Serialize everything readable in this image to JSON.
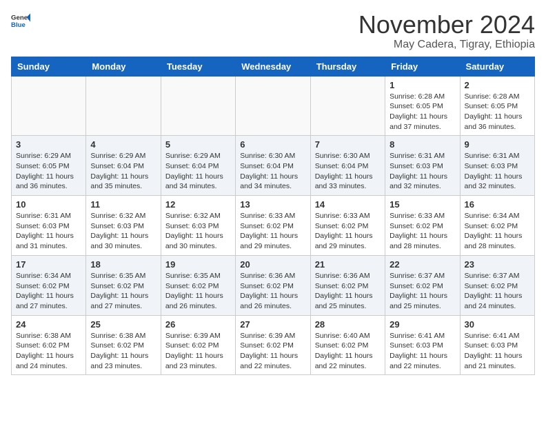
{
  "header": {
    "logo_general": "General",
    "logo_blue": "Blue",
    "month": "November 2024",
    "location": "May Cadera, Tigray, Ethiopia"
  },
  "weekdays": [
    "Sunday",
    "Monday",
    "Tuesday",
    "Wednesday",
    "Thursday",
    "Friday",
    "Saturday"
  ],
  "weeks": [
    [
      {
        "day": "",
        "info": ""
      },
      {
        "day": "",
        "info": ""
      },
      {
        "day": "",
        "info": ""
      },
      {
        "day": "",
        "info": ""
      },
      {
        "day": "",
        "info": ""
      },
      {
        "day": "1",
        "info": "Sunrise: 6:28 AM\nSunset: 6:05 PM\nDaylight: 11 hours and 37 minutes."
      },
      {
        "day": "2",
        "info": "Sunrise: 6:28 AM\nSunset: 6:05 PM\nDaylight: 11 hours and 36 minutes."
      }
    ],
    [
      {
        "day": "3",
        "info": "Sunrise: 6:29 AM\nSunset: 6:05 PM\nDaylight: 11 hours and 36 minutes."
      },
      {
        "day": "4",
        "info": "Sunrise: 6:29 AM\nSunset: 6:04 PM\nDaylight: 11 hours and 35 minutes."
      },
      {
        "day": "5",
        "info": "Sunrise: 6:29 AM\nSunset: 6:04 PM\nDaylight: 11 hours and 34 minutes."
      },
      {
        "day": "6",
        "info": "Sunrise: 6:30 AM\nSunset: 6:04 PM\nDaylight: 11 hours and 34 minutes."
      },
      {
        "day": "7",
        "info": "Sunrise: 6:30 AM\nSunset: 6:04 PM\nDaylight: 11 hours and 33 minutes."
      },
      {
        "day": "8",
        "info": "Sunrise: 6:31 AM\nSunset: 6:03 PM\nDaylight: 11 hours and 32 minutes."
      },
      {
        "day": "9",
        "info": "Sunrise: 6:31 AM\nSunset: 6:03 PM\nDaylight: 11 hours and 32 minutes."
      }
    ],
    [
      {
        "day": "10",
        "info": "Sunrise: 6:31 AM\nSunset: 6:03 PM\nDaylight: 11 hours and 31 minutes."
      },
      {
        "day": "11",
        "info": "Sunrise: 6:32 AM\nSunset: 6:03 PM\nDaylight: 11 hours and 30 minutes."
      },
      {
        "day": "12",
        "info": "Sunrise: 6:32 AM\nSunset: 6:03 PM\nDaylight: 11 hours and 30 minutes."
      },
      {
        "day": "13",
        "info": "Sunrise: 6:33 AM\nSunset: 6:02 PM\nDaylight: 11 hours and 29 minutes."
      },
      {
        "day": "14",
        "info": "Sunrise: 6:33 AM\nSunset: 6:02 PM\nDaylight: 11 hours and 29 minutes."
      },
      {
        "day": "15",
        "info": "Sunrise: 6:33 AM\nSunset: 6:02 PM\nDaylight: 11 hours and 28 minutes."
      },
      {
        "day": "16",
        "info": "Sunrise: 6:34 AM\nSunset: 6:02 PM\nDaylight: 11 hours and 28 minutes."
      }
    ],
    [
      {
        "day": "17",
        "info": "Sunrise: 6:34 AM\nSunset: 6:02 PM\nDaylight: 11 hours and 27 minutes."
      },
      {
        "day": "18",
        "info": "Sunrise: 6:35 AM\nSunset: 6:02 PM\nDaylight: 11 hours and 27 minutes."
      },
      {
        "day": "19",
        "info": "Sunrise: 6:35 AM\nSunset: 6:02 PM\nDaylight: 11 hours and 26 minutes."
      },
      {
        "day": "20",
        "info": "Sunrise: 6:36 AM\nSunset: 6:02 PM\nDaylight: 11 hours and 26 minutes."
      },
      {
        "day": "21",
        "info": "Sunrise: 6:36 AM\nSunset: 6:02 PM\nDaylight: 11 hours and 25 minutes."
      },
      {
        "day": "22",
        "info": "Sunrise: 6:37 AM\nSunset: 6:02 PM\nDaylight: 11 hours and 25 minutes."
      },
      {
        "day": "23",
        "info": "Sunrise: 6:37 AM\nSunset: 6:02 PM\nDaylight: 11 hours and 24 minutes."
      }
    ],
    [
      {
        "day": "24",
        "info": "Sunrise: 6:38 AM\nSunset: 6:02 PM\nDaylight: 11 hours and 24 minutes."
      },
      {
        "day": "25",
        "info": "Sunrise: 6:38 AM\nSunset: 6:02 PM\nDaylight: 11 hours and 23 minutes."
      },
      {
        "day": "26",
        "info": "Sunrise: 6:39 AM\nSunset: 6:02 PM\nDaylight: 11 hours and 23 minutes."
      },
      {
        "day": "27",
        "info": "Sunrise: 6:39 AM\nSunset: 6:02 PM\nDaylight: 11 hours and 22 minutes."
      },
      {
        "day": "28",
        "info": "Sunrise: 6:40 AM\nSunset: 6:02 PM\nDaylight: 11 hours and 22 minutes."
      },
      {
        "day": "29",
        "info": "Sunrise: 6:41 AM\nSunset: 6:03 PM\nDaylight: 11 hours and 22 minutes."
      },
      {
        "day": "30",
        "info": "Sunrise: 6:41 AM\nSunset: 6:03 PM\nDaylight: 11 hours and 21 minutes."
      }
    ]
  ]
}
